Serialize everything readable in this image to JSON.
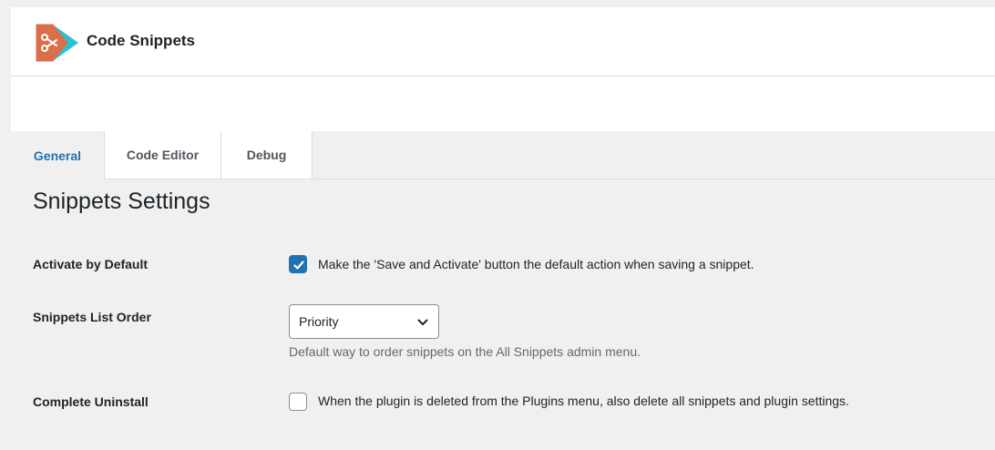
{
  "header": {
    "brand": "Code Snippets",
    "logo_icon": "scissors-logo-icon",
    "colors": {
      "logo_primary": "#d9704a",
      "logo_secondary": "#29c2d5"
    }
  },
  "tabs": [
    {
      "label": "General",
      "active": true
    },
    {
      "label": "Code Editor",
      "active": false
    },
    {
      "label": "Debug",
      "active": false
    }
  ],
  "page": {
    "title": "Snippets Settings"
  },
  "settings": {
    "activate": {
      "label": "Activate by Default",
      "checked": true,
      "description": "Make the 'Save and Activate' button the default action when saving a snippet."
    },
    "order": {
      "label": "Snippets List Order",
      "selected": "Priority",
      "description": "Default way to order snippets on the All Snippets admin menu."
    },
    "uninstall": {
      "label": "Complete Uninstall",
      "checked": false,
      "description": "When the plugin is deleted from the Plugins menu, also delete all snippets and plugin settings."
    }
  },
  "colors": {
    "accent": "#2271b1",
    "background": "#f0f0f1"
  }
}
